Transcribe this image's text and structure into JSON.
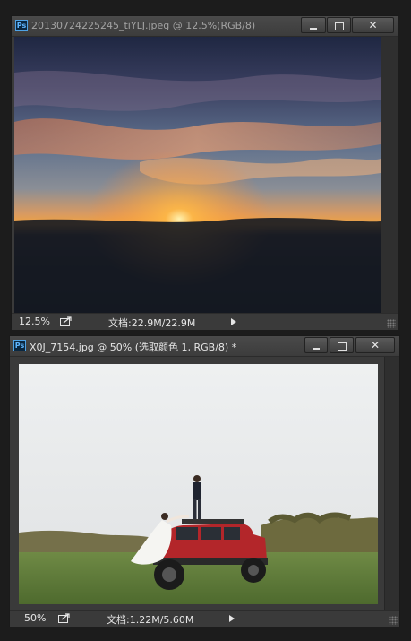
{
  "window1": {
    "title": "20130724225245_tiYLJ.jpeg @ 12.5%(RGB/8)",
    "zoom": "12.5%",
    "doc_size": "文档:22.9M/22.9M",
    "image_subject": "sunset above clouds"
  },
  "window2": {
    "title": "X0J_7154.jpg @ 50% (选取颜色 1, RGB/8) *",
    "zoom": "50%",
    "doc_size": "文档:1.22M/5.60M",
    "image_subject": "couple on red SUV in field"
  },
  "icons": {
    "app": "photoshop-icon",
    "minimize": "minimize-icon",
    "maximize": "maximize-icon",
    "close": "close-icon",
    "export": "export-icon",
    "menu": "play-arrow-icon",
    "grip": "resize-grip-icon"
  },
  "app_logo_text": "Ps"
}
